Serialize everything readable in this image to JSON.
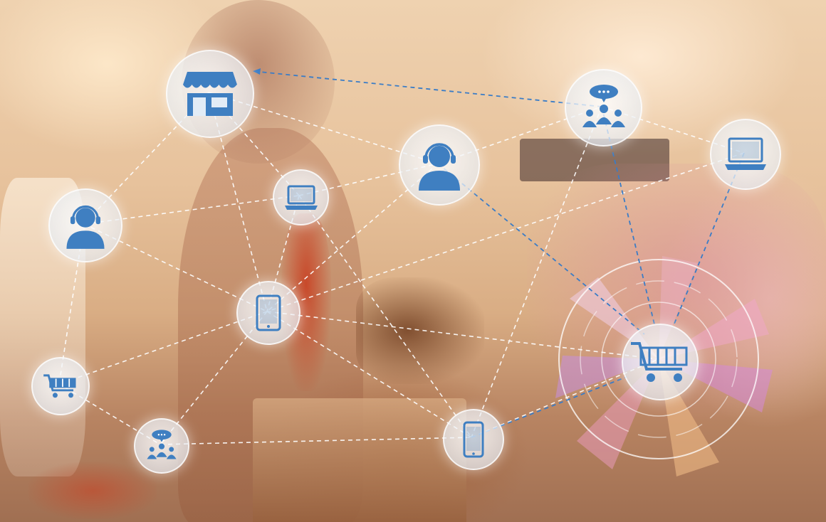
{
  "scene": {
    "description_tag": "omnichannel-retail-network",
    "icon_color": "#3f7fc1",
    "link_color_white": "#ffffff",
    "link_color_blue": "#3a7cc6"
  },
  "nodes": [
    {
      "name": "store-icon"
    },
    {
      "name": "group-chat-icon"
    },
    {
      "name": "laptop-icon"
    },
    {
      "name": "support-agent-icon"
    },
    {
      "name": "laptop-icon"
    },
    {
      "name": "support-agent-icon"
    },
    {
      "name": "tablet-icon"
    },
    {
      "name": "shopping-cart-icon"
    },
    {
      "name": "group-chat-icon"
    },
    {
      "name": "smartphone-icon"
    },
    {
      "name": "shopping-cart-icon"
    }
  ]
}
